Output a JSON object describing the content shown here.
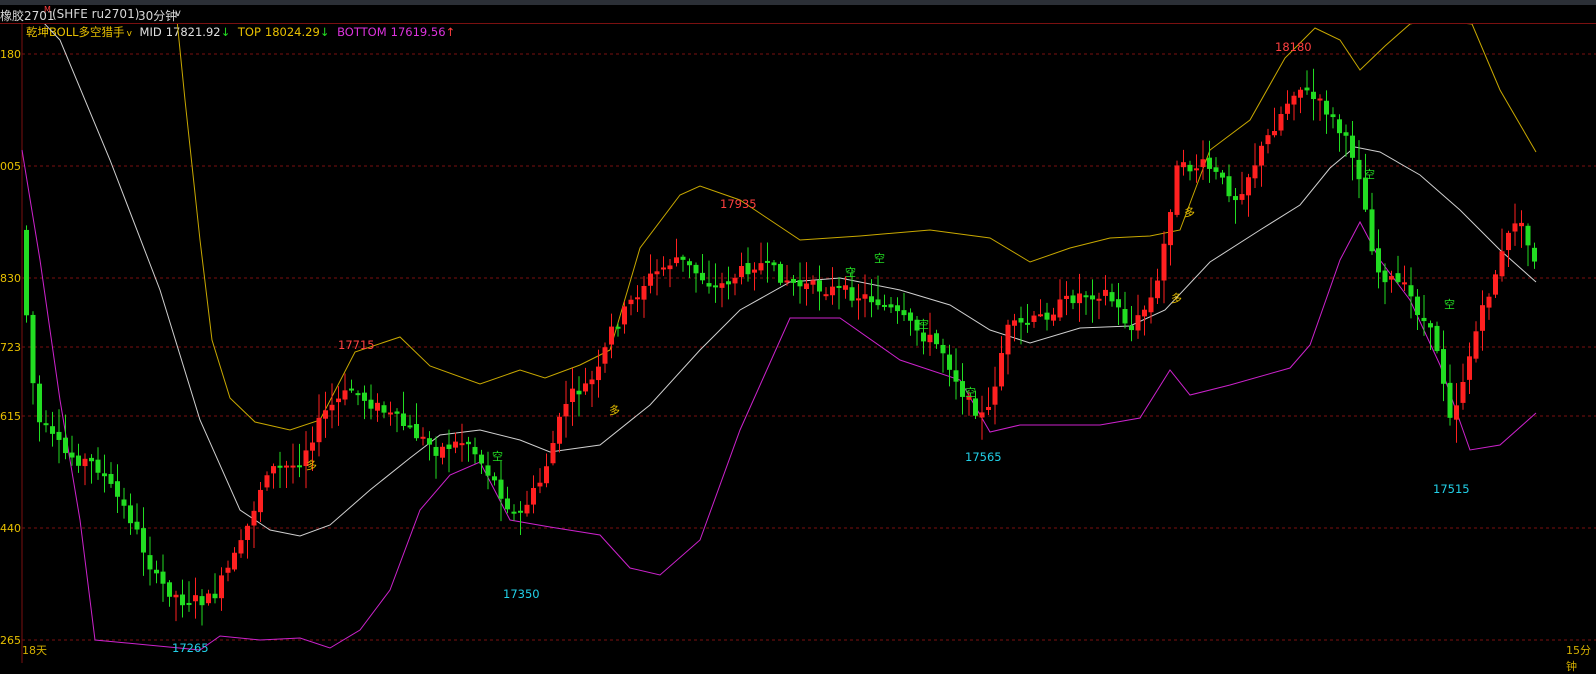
{
  "header": {
    "symbol": "橡胶2701",
    "symbol_flag": "M",
    "contract": "(SHFE ru2701)",
    "period": "30分钟",
    "period_caret": "v"
  },
  "indicator": {
    "name": "乾坤BOLL多空猎手",
    "caret": "v",
    "mid_label": "MID",
    "mid_value": "17821.92",
    "mid_arrow": "↓",
    "top_label": "TOP",
    "top_value": "18024.29",
    "top_arrow": "↓",
    "bottom_label": "BOTTOM",
    "bottom_value": "17619.56",
    "bottom_arrow": "↑"
  },
  "y_axis": [
    "180",
    "005",
    "830",
    "723",
    "615",
    "440",
    "265"
  ],
  "annotations": {
    "high_labels": [
      "17715",
      "17935",
      "18180"
    ],
    "low_labels": [
      "17265",
      "17350",
      "17565",
      "17515"
    ],
    "long_signal": "多",
    "short_signal": "空"
  },
  "footer": {
    "left_corner": "18天",
    "right_corner": "15分钟"
  },
  "colors": {
    "up": "#ff2020",
    "down": "#22dd22",
    "mid_line": "#d0d0d0",
    "top_line": "#c8a800",
    "bottom_line": "#cc22cc",
    "grid": "#7a1010",
    "high_label": "#ff4040",
    "low_label": "#22d0e8",
    "long_signal": "#e8c000",
    "short_signal": "#22dd22"
  }
}
